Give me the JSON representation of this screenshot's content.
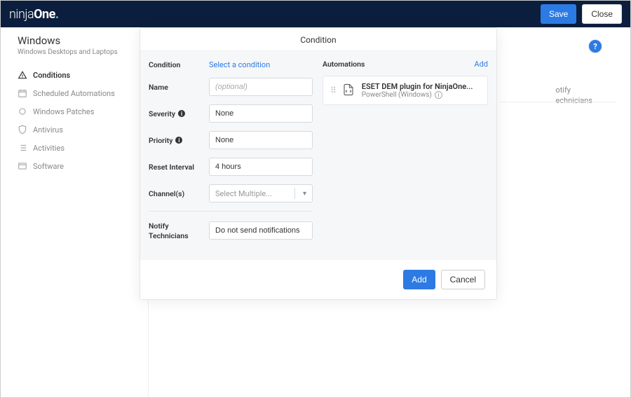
{
  "topbar": {
    "brand_part1": "ninja",
    "brand_part2": "One",
    "save": "Save",
    "close": "Close"
  },
  "page": {
    "title": "Windows",
    "subtitle": "Windows Desktops and Laptops"
  },
  "nav": {
    "conditions": "Conditions",
    "scheduled": "Scheduled Automations",
    "patches": "Windows Patches",
    "antivirus": "Antivirus",
    "activities": "Activities",
    "software": "Software"
  },
  "background": {
    "col_notify": "otify",
    "col_tech": "echnicians"
  },
  "help": {
    "symbol": "?"
  },
  "modal": {
    "title": "Condition",
    "labels": {
      "condition": "Condition",
      "name": "Name",
      "severity": "Severity",
      "priority": "Priority",
      "reset": "Reset Interval",
      "channels": "Channel(s)",
      "notify": "Notify Technicians"
    },
    "values": {
      "condition_link": "Select a condition",
      "name_placeholder": "(optional)",
      "severity": "None",
      "priority": "None",
      "reset": "4 hours",
      "channels_placeholder": "Select Multiple...",
      "notify": "Do not send notifications"
    },
    "automations": {
      "header": "Automations",
      "add": "Add",
      "item": {
        "name": "ESET DEM plugin for NinjaOne...",
        "meta": "PowerShell (Windows)"
      }
    },
    "footer": {
      "add": "Add",
      "cancel": "Cancel"
    }
  }
}
